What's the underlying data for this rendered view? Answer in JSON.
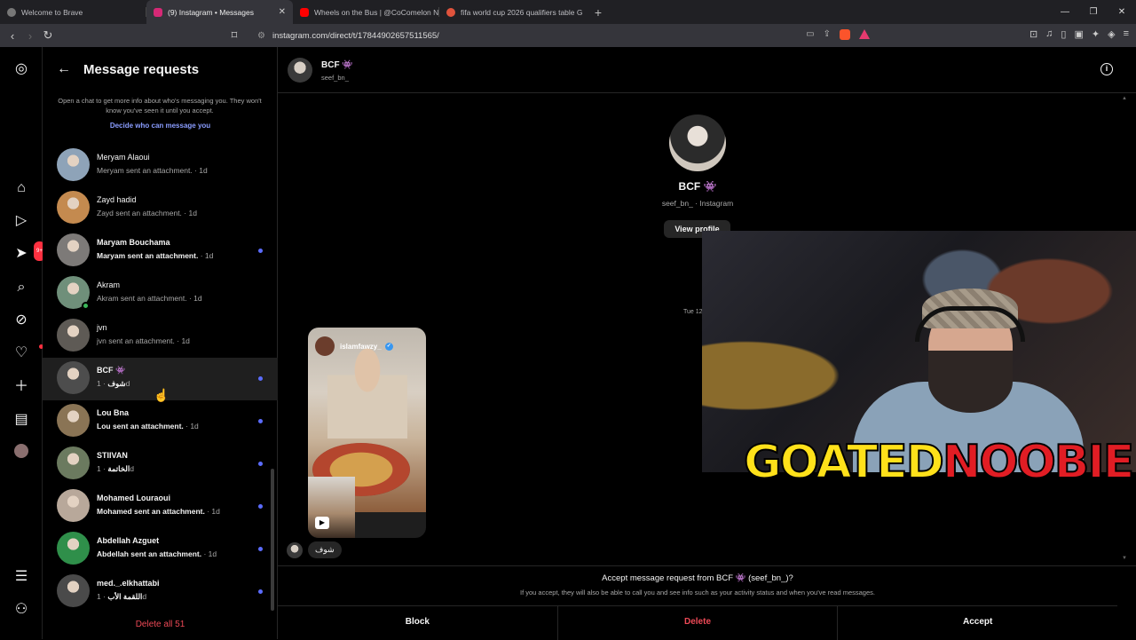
{
  "browser": {
    "tabs": [
      {
        "title": "Welcome to Brave",
        "color": "#777777",
        "active": false
      },
      {
        "title": "(9) Instagram • Messages",
        "color": "#d62976",
        "active": true
      },
      {
        "title": "Wheels on the Bus | @CoComelon N",
        "color": "#ff0000",
        "active": false
      },
      {
        "title": "fifa world cup 2026 qualifiers table G",
        "color": "#e0533c",
        "active": false
      }
    ],
    "url": "instagram.com/direct/t/17844902657511565/"
  },
  "nav": {
    "notifications_badge": "9+"
  },
  "requests_panel": {
    "title": "Message requests",
    "info": "Open a chat to get more info about who's messaging you. They won't know you've seen it until you accept.",
    "decide_link": "Decide who can message you",
    "items": [
      {
        "name": "Meryam Alaoui",
        "sub": "Meryam sent an attachment.",
        "time": "· 1d",
        "unread": false,
        "bg": "#8ea3b8"
      },
      {
        "name": "Zayd hadid",
        "sub": "Zayd sent an attachment.",
        "time": "· 1d",
        "unread": false,
        "bg": "#c48a4f"
      },
      {
        "name": "Maryam Bouchama",
        "sub": "Maryam sent an attachment.",
        "time": "· 1d",
        "unread": true,
        "bg": "#7d7a78"
      },
      {
        "name": "Akram",
        "sub": "Akram sent an attachment.",
        "time": "· 1d",
        "unread": false,
        "bg": "#6f8f7a"
      },
      {
        "name": "jvn",
        "sub": "jvn sent an attachment.",
        "time": "· 1d",
        "unread": false,
        "bg": "#5e5a55"
      },
      {
        "name": "BCF 👾",
        "sub": "شوف",
        "time": "· 1d",
        "unread": true,
        "bg": "#4d4d4d"
      },
      {
        "name": "Lou Bna",
        "sub": "Lou sent an attachment.",
        "time": "· 1d",
        "unread": true,
        "bg": "#8a7455"
      },
      {
        "name": "STIIVAN",
        "sub": "الخاتمة",
        "time": "· 1d",
        "unread": true,
        "bg": "#6b7a5f"
      },
      {
        "name": "Mohamed Louraoui",
        "sub": "Mohamed sent an attachment.",
        "time": "· 1d",
        "unread": true,
        "bg": "#b8a89a"
      },
      {
        "name": "Abdellah Azguet",
        "sub": "Abdellah sent an attachment.",
        "time": "· 1d",
        "unread": true,
        "bg": "#2f8f4a"
      },
      {
        "name": "med._.elkhattabi",
        "sub": "اللقمة الأب",
        "time": "· 1d",
        "unread": true,
        "bg": "#4a4a4a"
      }
    ],
    "delete_all": "Delete all 51"
  },
  "conversation": {
    "header_name": "BCF 👾",
    "header_username": "seef_bn_",
    "profile_name": "BCF 👾",
    "profile_sub": "seef_bn_ · Instagram",
    "view_profile": "View profile",
    "date": "Tue 12",
    "reel_user": "islamfawzy_",
    "message": "شوف",
    "accept_question": "Accept message request from BCF 👾 (seef_bn_)?",
    "accept_note": "If you accept, they will also be able to call you and see info such as your activity status and when you've read messages.",
    "block": "Block",
    "delete": "Delete",
    "accept": "Accept"
  },
  "overlay": {
    "part1": "GOATED",
    "part2": "NOOBIE"
  }
}
